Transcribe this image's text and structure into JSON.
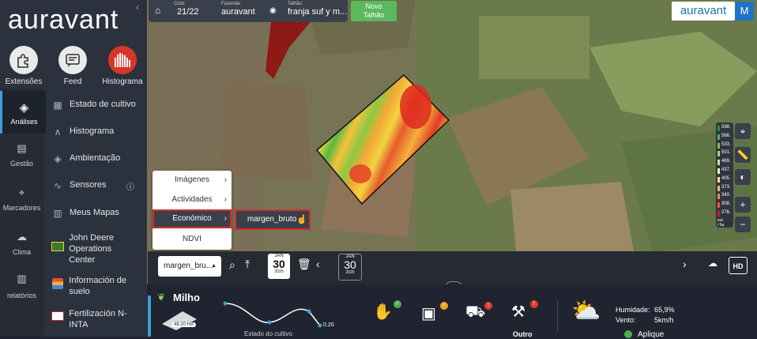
{
  "sidebar": {
    "logo": "auravant",
    "top_buttons": [
      {
        "label": "Extensões",
        "icon": "puzzle-icon"
      },
      {
        "label": "Feed",
        "icon": "feed-icon"
      },
      {
        "label": "Histograma",
        "icon": "histogram-icon"
      }
    ],
    "nav": [
      {
        "label": "Análises",
        "icon": "layers-icon",
        "active": true
      },
      {
        "label": "Gestão",
        "icon": "clipboard-icon"
      },
      {
        "label": "Marcadores",
        "icon": "pin-icon"
      },
      {
        "label": "Clima",
        "icon": "cloud-icon"
      },
      {
        "label": "relatórios",
        "icon": "report-icon"
      }
    ],
    "menu": [
      {
        "label": "Estado de cultivo",
        "icon": "crop-icon"
      },
      {
        "label": "Histograma",
        "icon": "curve-icon"
      },
      {
        "label": "Ambientação",
        "icon": "stack-icon"
      },
      {
        "label": "Sensores",
        "icon": "pulse-icon"
      },
      {
        "label": "Meus Mapas",
        "icon": "map-icon"
      },
      {
        "label": "John Deere Operations Center",
        "icon": "jd-logo-icon"
      },
      {
        "label": "Información de suelo",
        "icon": "soil-icon"
      },
      {
        "label": "Fertilización N-INTA",
        "icon": "inta-logo-icon"
      }
    ]
  },
  "topbar": {
    "ciclo_label": "Ciclo:",
    "ciclo_value": "21/22",
    "fazenda_label": "Fazenda:",
    "fazenda_value": "auravant",
    "talhao_label": "Talhão:",
    "talhao_value": "franja suf y m...",
    "new_field_line1": "Novo",
    "new_field_line2": "Talhão",
    "brand": "auravant",
    "avatar_initial": "M"
  },
  "dropdown": {
    "items": [
      "Imágenes",
      "Actividades",
      "Económico",
      "NDVI"
    ],
    "submenu_item": "margen_bruto"
  },
  "bottom_bar": {
    "layer_select": "margen_bru...",
    "date1": {
      "month": "JAN",
      "day": "30",
      "year": "2020"
    },
    "date2": {
      "month": "JAN",
      "day": "30",
      "year": "2020"
    },
    "hd_label": "HD"
  },
  "legend": {
    "values": [
      "598.",
      "566.",
      "533.",
      "501.",
      "469.",
      "437.",
      "405.",
      "373.",
      "340.",
      "308.",
      "276."
    ],
    "colors": [
      "#1a9641",
      "#4fb24a",
      "#7bc44c",
      "#a6d96a",
      "#c9e68a",
      "#eef5b0",
      "#fee08b",
      "#fdb863",
      "#f68a4b",
      "#e8553a",
      "#d7191c"
    ],
    "unit_line1": "eur",
    "unit_line2": "/ ha"
  },
  "crop_panel": {
    "crop_name": "Milho",
    "area": "48.20 HA",
    "curve_value": "0.20",
    "curve_label": "Estado do cultivo",
    "activity_label": "Outro",
    "humidity_label": "Humidade:",
    "humidity_value": "65,9%",
    "wind_label": "Vento:",
    "wind_value": "5km/h",
    "apply_label": "Aplique"
  }
}
